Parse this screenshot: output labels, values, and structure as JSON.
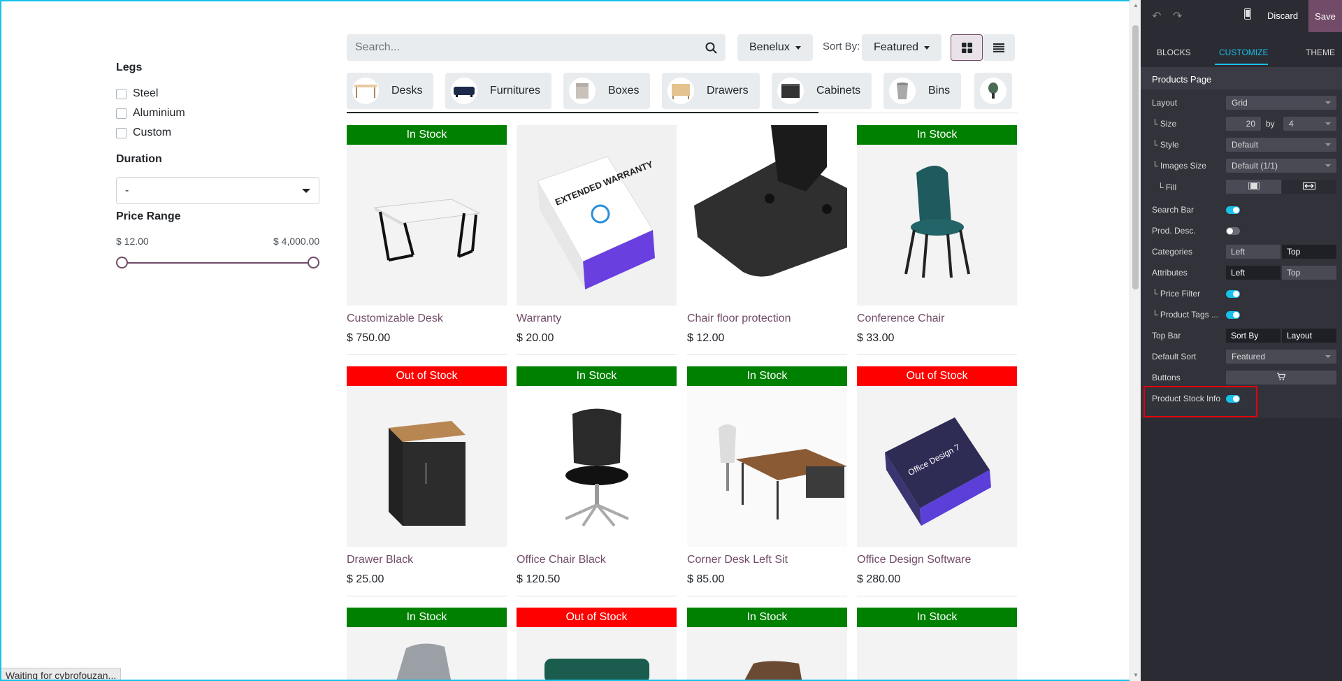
{
  "filters": {
    "legs_title": "Legs",
    "legs_options": [
      "Steel",
      "Aluminium",
      "Custom"
    ],
    "duration_title": "Duration",
    "duration_value": "-",
    "price_title": "Price Range",
    "price_min": "$ 12.00",
    "price_max": "$ 4,000.00"
  },
  "topbar": {
    "search_placeholder": "Search...",
    "pricelist": "Benelux",
    "sort_label": "Sort By:",
    "sort_value": "Featured"
  },
  "categories": [
    "Desks",
    "Furnitures",
    "Boxes",
    "Drawers",
    "Cabinets",
    "Bins"
  ],
  "products": [
    {
      "badge": "In Stock",
      "name": "Customizable Desk",
      "price": "$ 750.00"
    },
    {
      "badge": "",
      "name": "Warranty",
      "price": "$ 20.00"
    },
    {
      "badge": "",
      "name": "Chair floor protection",
      "price": "$ 12.00"
    },
    {
      "badge": "In Stock",
      "name": "Conference Chair",
      "price": "$ 33.00"
    },
    {
      "badge": "Out of Stock",
      "name": "Drawer Black",
      "price": "$ 25.00"
    },
    {
      "badge": "In Stock",
      "name": "Office Chair Black",
      "price": "$ 120.50"
    },
    {
      "badge": "In Stock",
      "name": "Corner Desk Left Sit",
      "price": "$ 85.00"
    },
    {
      "badge": "Out of Stock",
      "name": "Office Design Software",
      "price": "$ 280.00"
    },
    {
      "badge": "In Stock",
      "name": "",
      "price": ""
    },
    {
      "badge": "Out of Stock",
      "name": "",
      "price": ""
    },
    {
      "badge": "In Stock",
      "name": "",
      "price": ""
    },
    {
      "badge": "In Stock",
      "name": "",
      "price": ""
    }
  ],
  "product_images": {
    "warranty_box_text": "EXTENDED WARRANTY",
    "software_box_text": "Office Design 7"
  },
  "status_bar": "Waiting for cybrofouzan...",
  "editor": {
    "discard": "Discard",
    "save": "Save",
    "tabs": [
      "BLOCKS",
      "CUSTOMIZE",
      "THEME"
    ],
    "section": "Products Page",
    "layout_label": "Layout",
    "layout_value": "Grid",
    "size_label": "└ Size",
    "size_cols": "20",
    "size_by": "by",
    "size_rows": "4",
    "style_label": "└ Style",
    "style_value": "Default",
    "images_size_label": "└ Images Size",
    "images_size_value": "Default (1/1)",
    "fill_label": "└ Fill",
    "search_bar_label": "Search Bar",
    "prod_desc_label": "Prod. Desc.",
    "categories_label": "Categories",
    "categories_left": "Left",
    "categories_top": "Top",
    "attributes_label": "Attributes",
    "attributes_left": "Left",
    "attributes_top": "Top",
    "price_filter_label": "└ Price Filter",
    "product_tags_label": "└ Product Tags ...",
    "top_bar_label": "Top Bar",
    "top_bar_sort": "Sort By",
    "top_bar_layout": "Layout",
    "default_sort_label": "Default Sort",
    "default_sort_value": "Featured",
    "buttons_label": "Buttons",
    "stock_info_label": "Product Stock Info"
  },
  "colors": {
    "brand": "#714b67",
    "accent": "#17c1e8",
    "in_stock": "#008000",
    "out_of_stock": "#ff0000",
    "panel_bg": "#2b2b33"
  }
}
